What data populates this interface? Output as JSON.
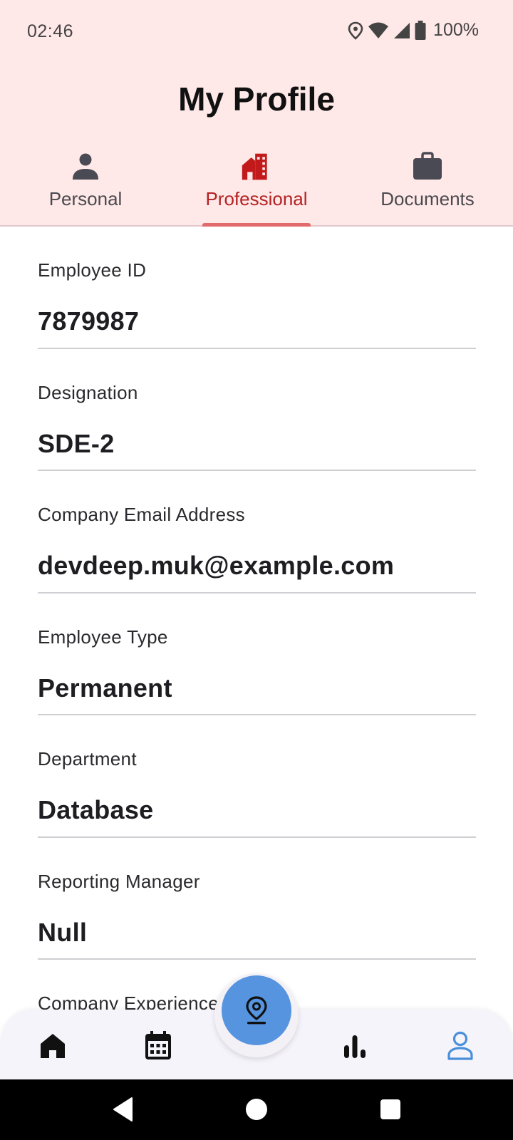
{
  "status_bar": {
    "time": "02:46",
    "battery": "100%"
  },
  "header": {
    "title": "My Profile"
  },
  "tabs": [
    {
      "label": "Personal",
      "icon": "person-icon",
      "active": false
    },
    {
      "label": "Professional",
      "icon": "office-building-icon",
      "active": true
    },
    {
      "label": "Documents",
      "icon": "briefcase-icon",
      "active": false
    }
  ],
  "fields": [
    {
      "label": "Employee ID",
      "value": "7879987"
    },
    {
      "label": "Designation",
      "value": "SDE-2"
    },
    {
      "label": "Company Email Address",
      "value": "devdeep.muk@example.com"
    },
    {
      "label": "Employee Type",
      "value": "Permanent"
    },
    {
      "label": "Department",
      "value": "Database"
    },
    {
      "label": "Reporting Manager",
      "value": "Null"
    },
    {
      "label": "Company Experience Period",
      "value": ""
    }
  ],
  "bottom_nav": {
    "items": [
      "home-icon",
      "calendar-icon",
      "location-pin-icon",
      "bar-chart-icon",
      "profile-icon"
    ],
    "active": "profile-icon"
  },
  "colors": {
    "header_bg": "#ffe8e8",
    "accent_red": "#b52222",
    "fab_blue": "#5694e0",
    "active_nav": "#4a8fd9"
  }
}
